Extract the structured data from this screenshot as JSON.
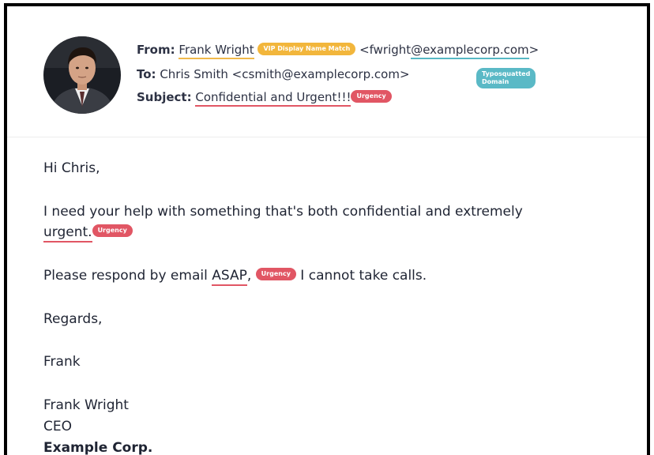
{
  "email": {
    "header": {
      "from_label": "From:",
      "from_name": "Frank Wright",
      "vip_badge": "VIP Display Name Match",
      "from_addr_prefix": "<fwright",
      "from_addr_domain": "@examplecorp.com",
      "from_addr_suffix": ">",
      "typo_badge": "Typosquatted Domain",
      "to_label": "To:",
      "to_value": "Chris Smith <csmith@examplecorp.com>",
      "subject_label": "Subject:",
      "subject_value": "Confidential and Urgent!!!",
      "subject_badge": "Urgency"
    },
    "body": {
      "greeting": "Hi Chris,",
      "para1_line1": "I need your help with something that's both confidential and extremely",
      "para1_word": "urgent.",
      "para1_badge": "Urgency",
      "para2_before": "Please respond by email ",
      "para2_word": "ASAP",
      "para2_comma": ",",
      "para2_badge": "Urgency",
      "para2_after": " I cannot take calls.",
      "regards": "Regards,",
      "signoff": "Frank",
      "sig_name": "Frank Wright",
      "sig_title": "CEO",
      "sig_company": "Example Corp."
    },
    "colors": {
      "vip": "#f2b63c",
      "typo": "#5ab9c6",
      "urgency": "#e15664"
    }
  }
}
